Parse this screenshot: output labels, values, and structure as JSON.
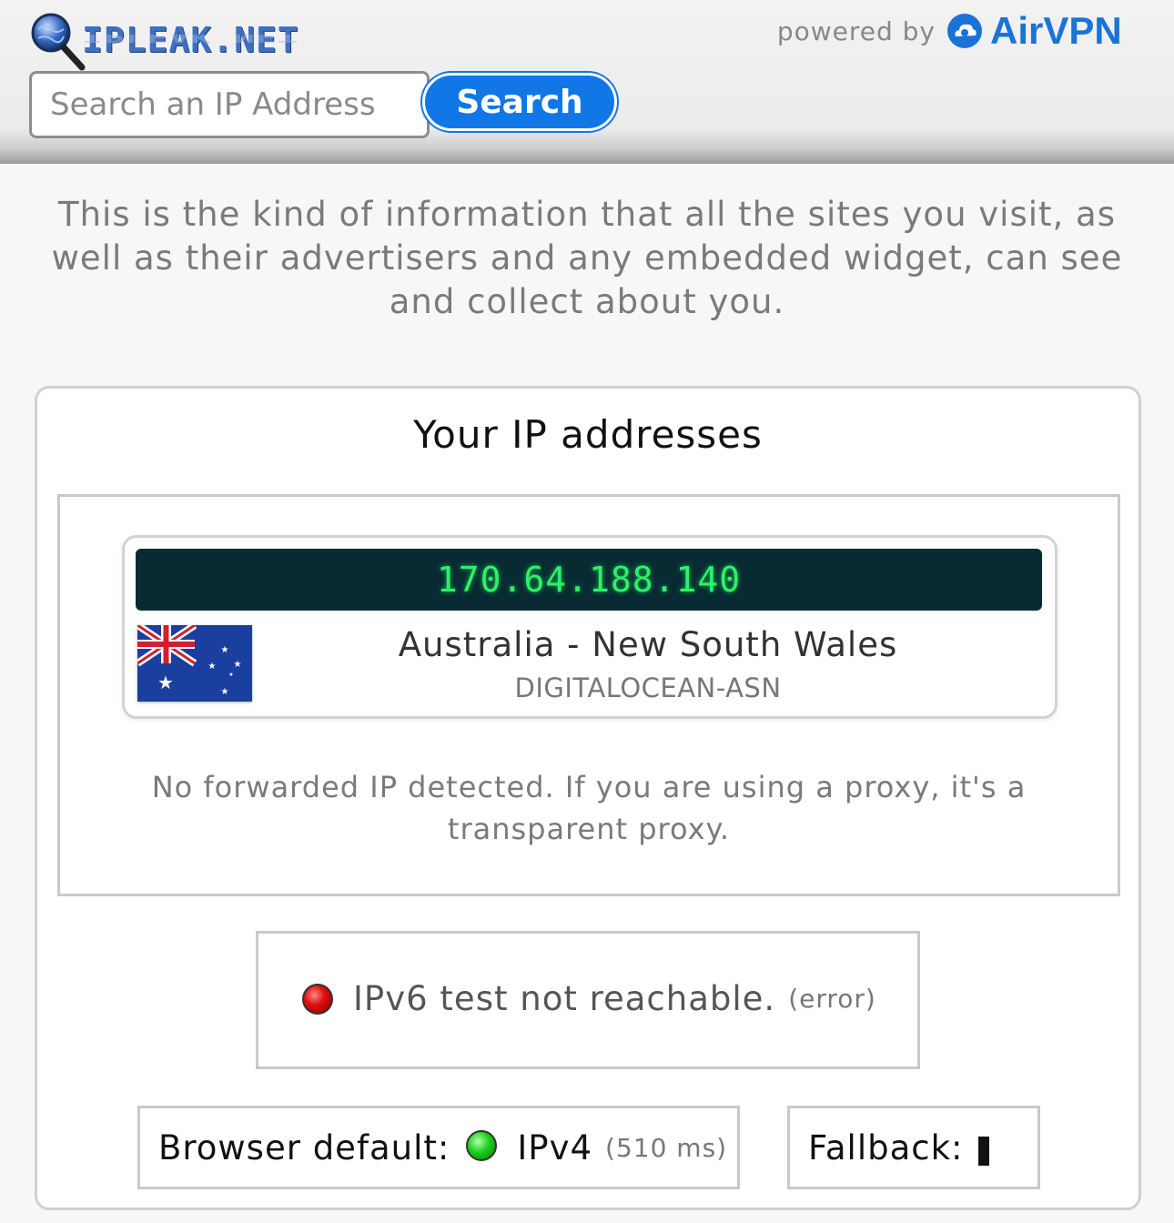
{
  "header": {
    "logo_text": "IPLEAK.NET",
    "powered_by": "powered by",
    "brand": "AirVPN",
    "search_placeholder": "Search an IP Address",
    "search_button": "Search"
  },
  "intro": "This is the kind of information that all the sites you visit, as well as their advertisers and any embedded widget, can see and collect about you.",
  "ip_panel": {
    "title": "Your IP addresses",
    "ip_address": "170.64.188.140",
    "location": "Australia - New South Wales",
    "asn": "DIGITALOCEAN-ASN",
    "country_flag": "australia-flag",
    "forwarded_note": "No forwarded IP detected. If you are using a proxy, it's a transparent proxy."
  },
  "ipv6_test": {
    "status_color": "#e01010",
    "text": "IPv6 test not reachable.",
    "note": "(error)"
  },
  "browser_default": {
    "label": "Browser default:",
    "status_color": "#19d019",
    "protocol": "IPv4",
    "latency": "(510 ms)"
  },
  "fallback": {
    "label": "Fallback:"
  },
  "colors": {
    "accent": "#1177e6",
    "ip_bar_bg": "#082a33",
    "ip_text": "#2ef06a"
  }
}
